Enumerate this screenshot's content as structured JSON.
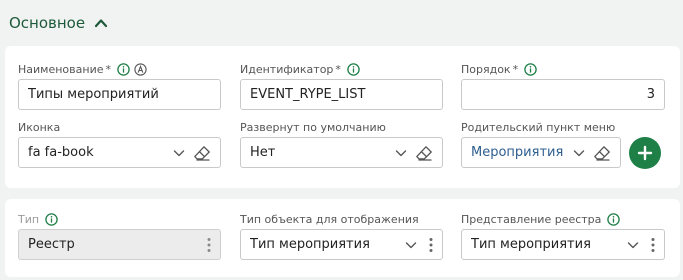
{
  "section": {
    "title": "Основное"
  },
  "colors": {
    "accent": "#1e7f47",
    "title": "#1d5a3a",
    "link": "#2e5e8e"
  },
  "fields": {
    "name": {
      "label": "Наименование",
      "required_mark": "*",
      "value": "Типы мероприятий"
    },
    "identifier": {
      "label": "Идентификатор",
      "required_mark": "*",
      "value": "EVENT_RYPE_LIST"
    },
    "order": {
      "label": "Порядок",
      "required_mark": "*",
      "value": "3"
    },
    "icon": {
      "label": "Иконка",
      "value": "fa fa-book"
    },
    "expanded": {
      "label": "Развернут по умолчанию",
      "value": "Нет"
    },
    "parent_menu": {
      "label": "Родительский пункт меню",
      "value": "Мероприятия"
    },
    "type": {
      "label": "Тип",
      "value": "Реестр"
    },
    "object_type": {
      "label": "Тип объекта для отображения",
      "value": "Тип мероприятия"
    },
    "registry_view": {
      "label": "Представление реестра",
      "value": "Тип мероприятия"
    }
  },
  "icons": [
    "chevron-up-icon",
    "info-icon",
    "a-circle-icon",
    "chevron-down-icon",
    "eraser-icon",
    "more-vertical-icon",
    "plus-icon"
  ]
}
